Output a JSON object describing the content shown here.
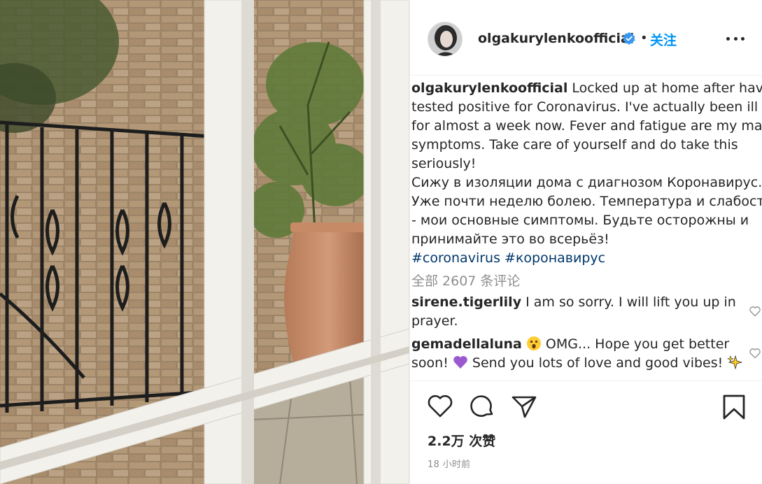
{
  "post": {
    "username": "olgakurylenkoofficial",
    "follow_label": "关注",
    "separator": "•"
  },
  "caption": {
    "username": "olgakurylenkoofficial",
    "lines": [
      "Locked up at home after having",
      "tested positive for Coronavirus. I've actually been ill",
      "for almost a week now. Fever and fatigue are my main",
      "symptoms. Take care of yourself and do take this",
      "seriously!",
      "Сижу в изоляции дома с диагнозом Коронавирус.",
      "Уже почти неделю болею. Температура и слабость",
      "- мои основные симптомы. Будьте осторожны и",
      "принимайте это во всерьёз!"
    ],
    "hashtags": [
      "#coronavirus",
      "#коронавирус"
    ]
  },
  "view_all_comments": "全部 2607 条评论",
  "comments": [
    {
      "username": "sirene.tigerlily",
      "text_line1": "I am so sorry. I will lift you up in",
      "text_line2": "prayer."
    },
    {
      "username": "gemadellaluna",
      "text_line1_a": "OMG... Hope you get better",
      "text_line2_a": "soon!",
      "text_line2_b": "Send you lots of love and good vibes!",
      "emojis": [
        "astonished-face",
        "purple-heart",
        "sparkles"
      ]
    }
  ],
  "likes_label": "2.2万 次赞",
  "timestamp": "18 小时前",
  "icons": [
    "verified-badge",
    "more-options",
    "heart",
    "comment",
    "share",
    "bookmark"
  ],
  "colors": {
    "link_blue": "#0095f6",
    "verified_blue": "#3897f0",
    "hashtag": "#00376b",
    "muted": "#8e8e8e",
    "text": "#262626"
  }
}
